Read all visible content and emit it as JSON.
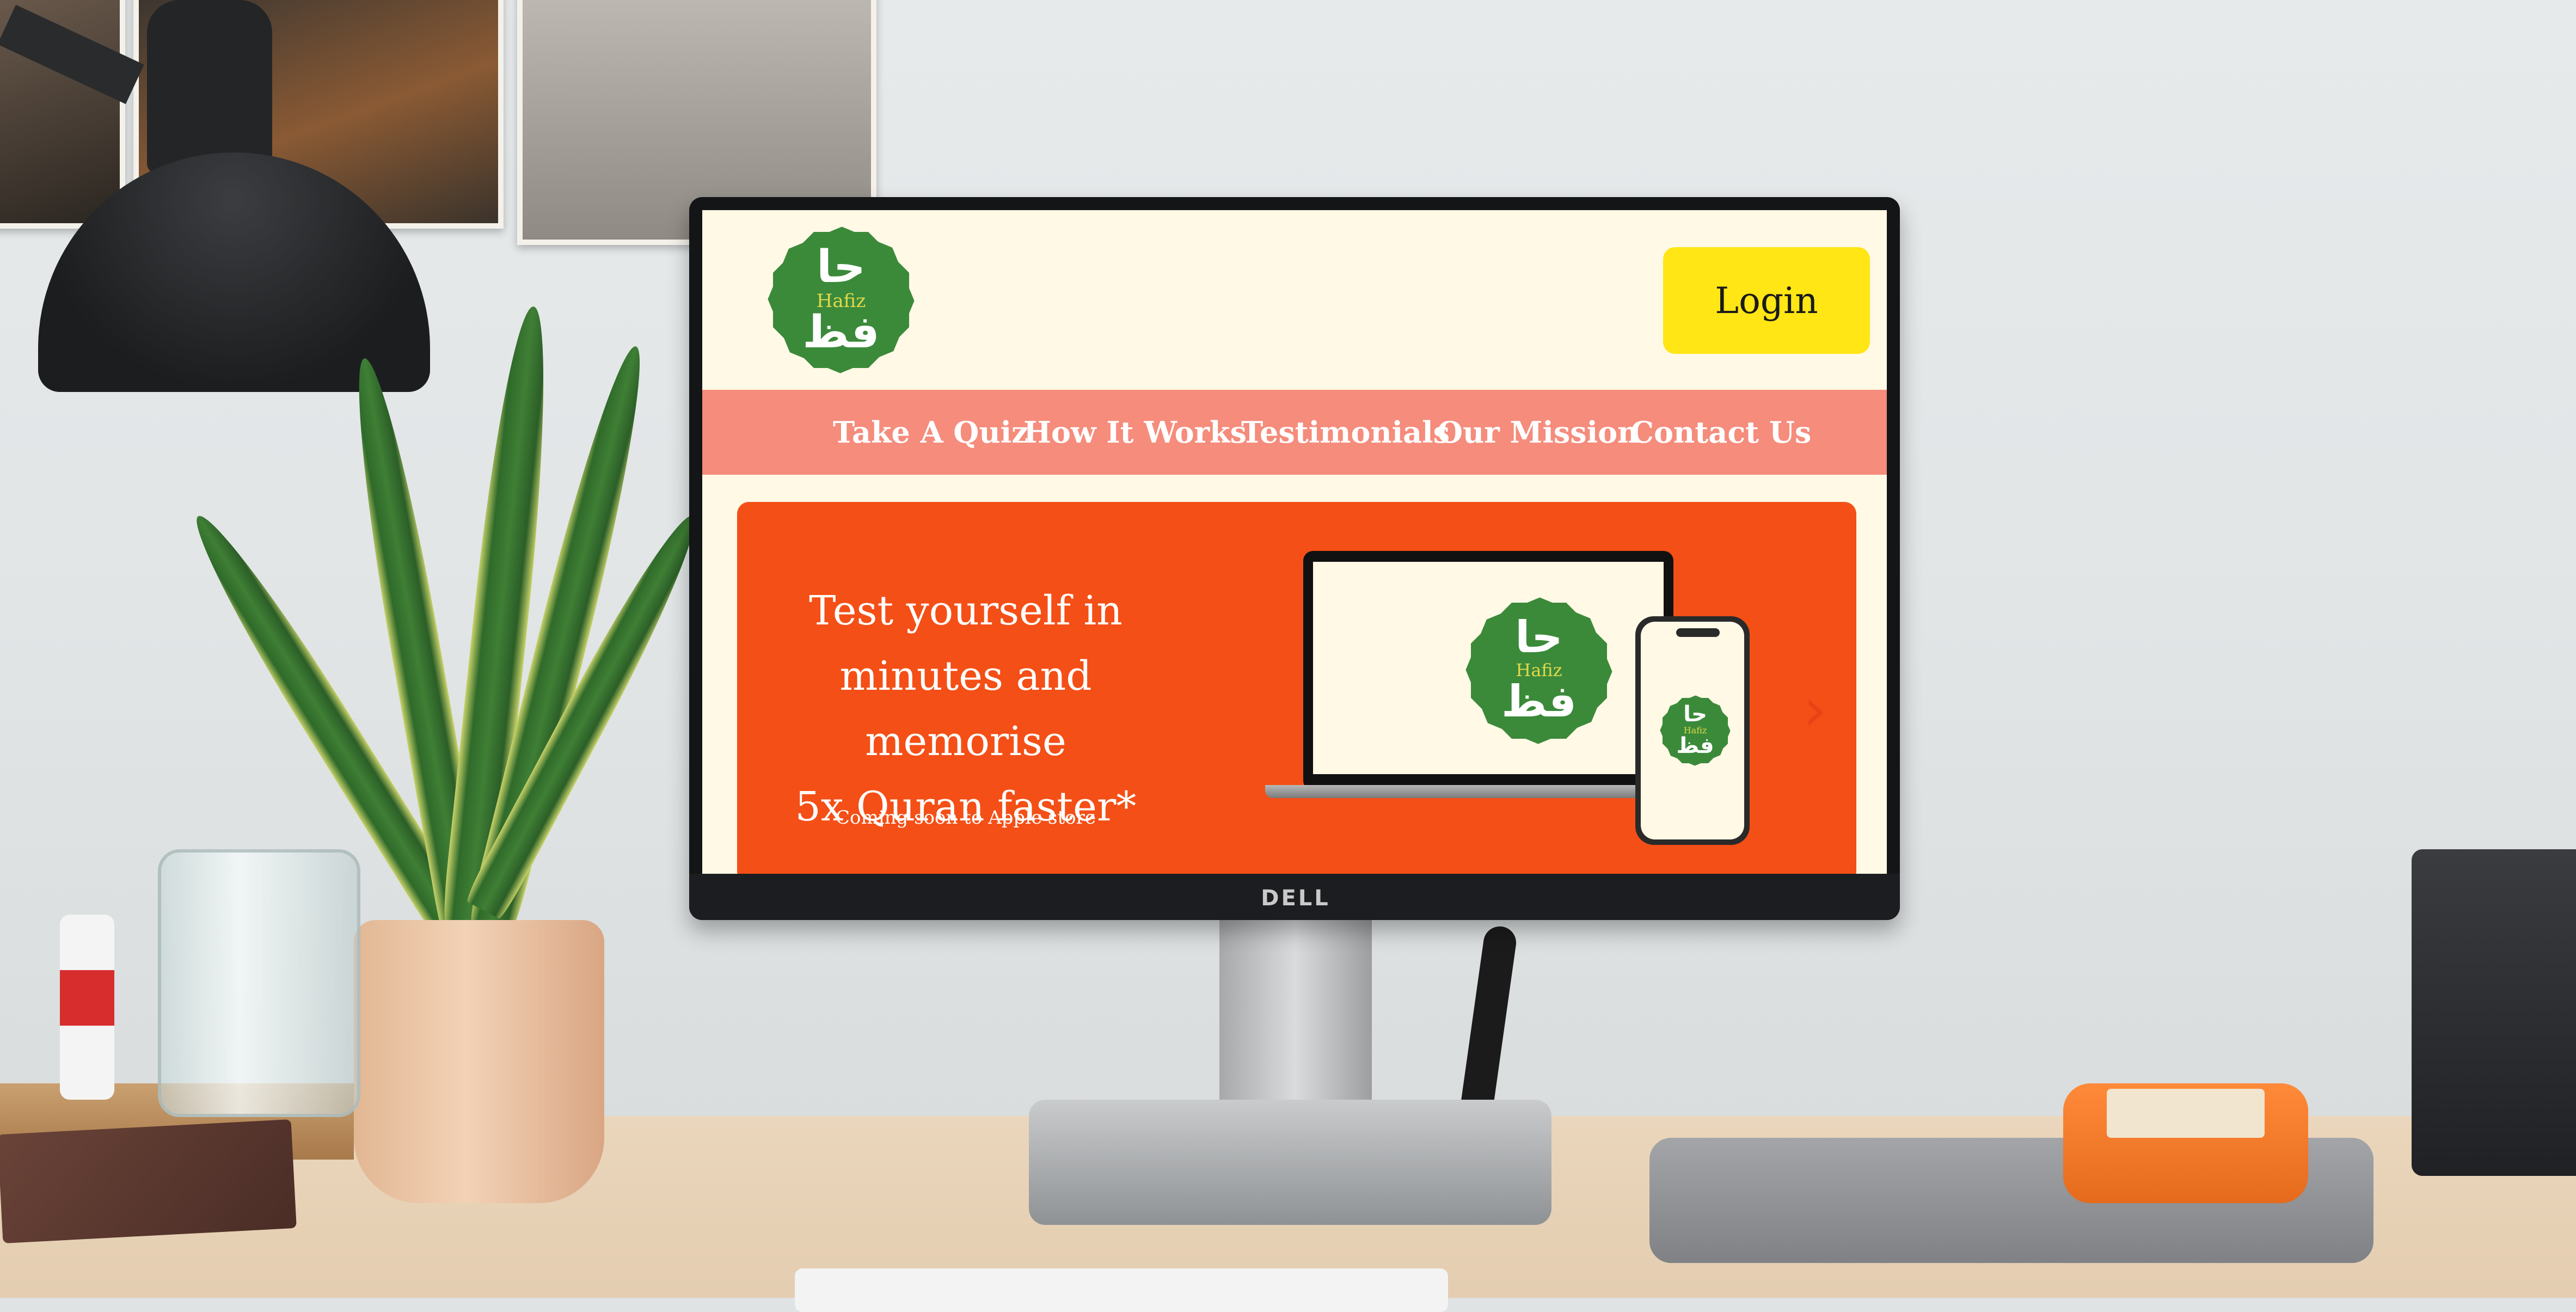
{
  "monitor": {
    "brand": "DELL"
  },
  "site": {
    "logo": {
      "top_glyph": "حا",
      "brand": "Hafiz",
      "bottom_glyph": "فظ"
    },
    "header": {
      "login_label": "Login"
    },
    "nav": {
      "items": [
        {
          "label": "Take A Quiz"
        },
        {
          "label": "How It Works"
        },
        {
          "label": "Testimonials"
        },
        {
          "label": "Our Mission"
        },
        {
          "label": "Contact Us"
        }
      ]
    },
    "hero": {
      "headline": "Test yourself in\nminutes and memorise\n5x Quran faster*",
      "subtext": "Coming soon to Apple store",
      "next_arrow": "›"
    },
    "colors": {
      "background": "#fff9e5",
      "nav": "#f58c7c",
      "hero": "#f44f16",
      "login": "#ffe614",
      "logo_green": "#3b8a3a"
    },
    "icons": {
      "carousel_next": "chevron-right-icon"
    }
  }
}
